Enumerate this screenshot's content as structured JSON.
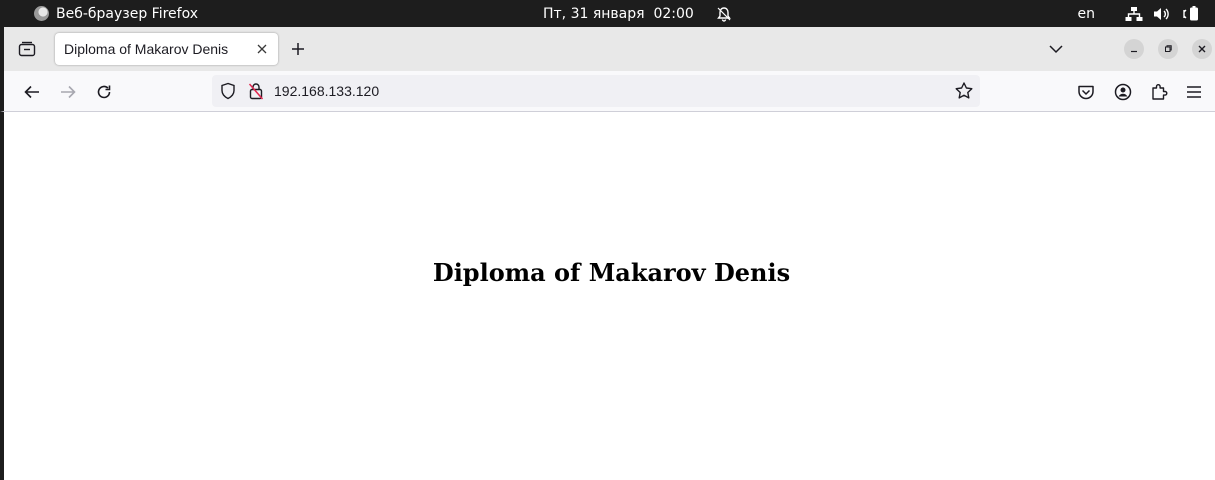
{
  "system_panel": {
    "app_name": "Веб-браузер Firefox",
    "datetime": "Пт, 31 января  02:00",
    "language": "en"
  },
  "browser": {
    "tabs": [
      {
        "title": "Diploma of Makarov Denis",
        "active": true
      }
    ],
    "address_bar": {
      "url": "192.168.133.120"
    }
  },
  "page": {
    "heading": "Diploma of Makarov Denis"
  },
  "colors": {
    "panel_bg": "#1d1d1d",
    "tabbar_bg": "#e8e8e8",
    "navbar_bg": "#f9f9fb",
    "urlbar_bg": "#f0f0f4"
  }
}
